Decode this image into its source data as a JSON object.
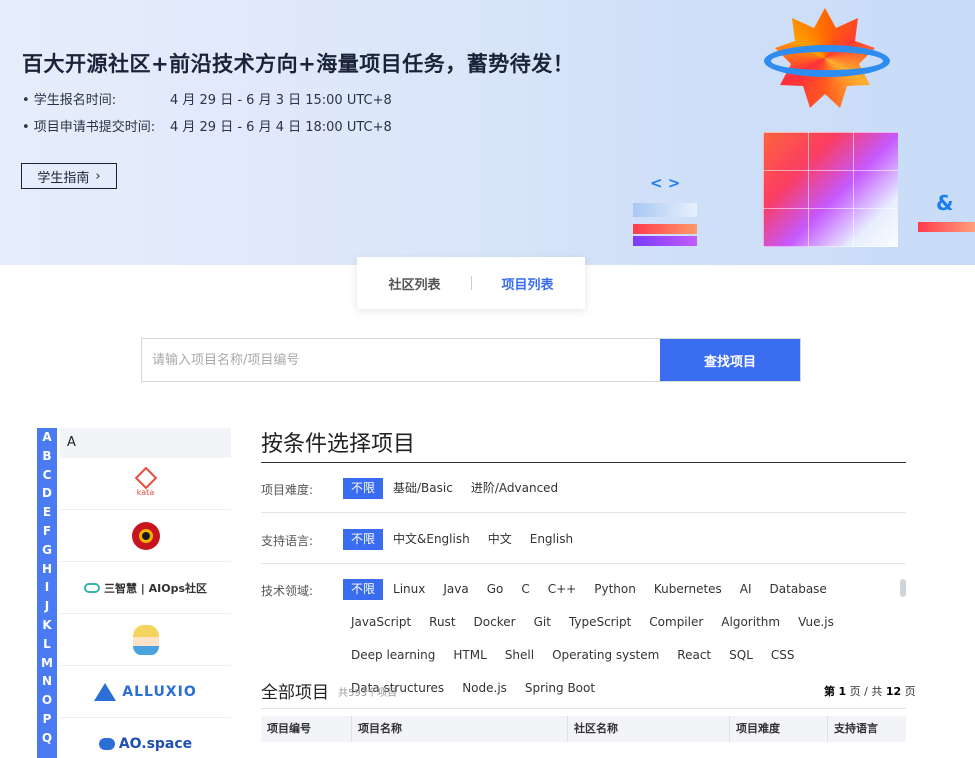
{
  "banner": {
    "title": "百大开源社区+前沿技术方向+海量项目任务，蓄势待发！",
    "lines": [
      {
        "label": "• 学生报名时间:",
        "value": "4 月 29 日 - 6 月 3 日 15:00 UTC+8"
      },
      {
        "label": "• 项目申请书提交时间:",
        "value": "4 月 29 日 - 6 月 4 日 18:00 UTC+8"
      }
    ],
    "guide_button": "学生指南",
    "code_glyph": "< >",
    "amp_glyph": "&"
  },
  "tabs": [
    {
      "label": "社区列表",
      "active": false
    },
    {
      "label": "项目列表",
      "active": true
    }
  ],
  "search": {
    "placeholder": "请输入项目名称/项目编号",
    "button": "查找项目"
  },
  "alpha_index": [
    "A",
    "B",
    "C",
    "D",
    "E",
    "F",
    "G",
    "H",
    "I",
    "J",
    "K",
    "L",
    "M",
    "N",
    "O",
    "P",
    "Q"
  ],
  "community_list": {
    "current_letter": "A",
    "items": [
      {
        "name": "kata",
        "icon": "kata-logo"
      },
      {
        "name": "",
        "icon": "circle-logo"
      },
      {
        "name": "三智慧 | AIOps社区",
        "icon": "aiops-logo"
      },
      {
        "name": "",
        "icon": "avatar-logo"
      },
      {
        "name": "ALLUXIO",
        "icon": "alluxio-logo"
      },
      {
        "name": "AO.space",
        "icon": "aospace-logo"
      }
    ]
  },
  "filter": {
    "title": "按条件选择项目",
    "difficulty": {
      "label": "项目难度:",
      "options": [
        "不限",
        "基础/Basic",
        "进阶/Advanced"
      ],
      "selected": 0
    },
    "language": {
      "label": "支持语言:",
      "options": [
        "不限",
        "中文&English",
        "中文",
        "English"
      ],
      "selected": 0
    },
    "tech": {
      "label": "技术领域:",
      "options": [
        "不限",
        "Linux",
        "Java",
        "Go",
        "C",
        "C++",
        "Python",
        "Kubernetes",
        "AI",
        "Database",
        "JavaScript",
        "Rust",
        "Docker",
        "Git",
        "TypeScript",
        "Compiler",
        "Algorithm",
        "Vue.js",
        "Deep learning",
        "HTML",
        "Shell",
        "Operating system",
        "React",
        "SQL",
        "CSS",
        "Data structures",
        "Node.js",
        "Spring Boot"
      ],
      "selected": 0
    }
  },
  "projects": {
    "title": "全部项目",
    "count": "共593个项目",
    "pager_prefix": "第",
    "current_page": "1",
    "pager_mid": "页 / 共",
    "total_pages": "12",
    "pager_suffix": "页",
    "columns": [
      "项目编号",
      "项目名称",
      "社区名称",
      "项目难度",
      "支持语言"
    ]
  },
  "colors": {
    "accent": "#3a6cf0",
    "alpha_bar": "#4b7bf2"
  }
}
